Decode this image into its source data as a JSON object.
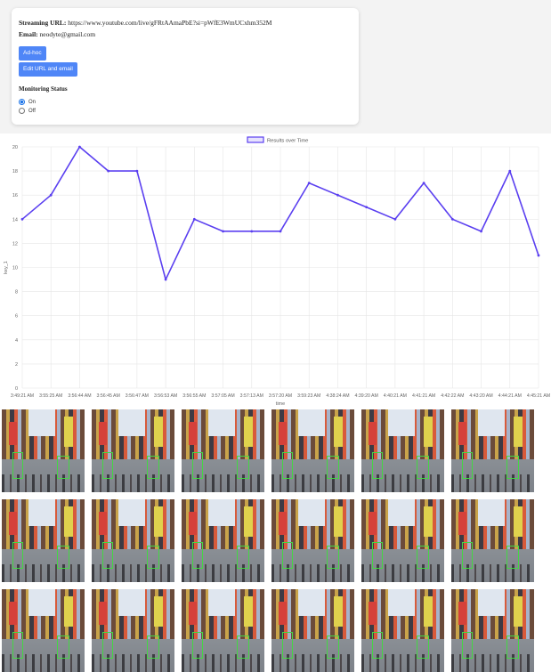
{
  "info": {
    "url_label": "Streaming URL:",
    "url_value": "https://www.youtube.com/live/gFRtAAmaPbE?si=pWfE3WmUCxhm352M",
    "email_label": "Email:",
    "email_value": "neodyte@gmail.com"
  },
  "buttons": {
    "adhoc": "Ad-hoc",
    "edit": "Edit URL and email"
  },
  "monitoring": {
    "title": "Monitoring Status",
    "options": [
      {
        "label": "On",
        "checked": true
      },
      {
        "label": "Off",
        "checked": false
      }
    ]
  },
  "colors": {
    "accent": "#4f86f7",
    "line": "#5a3ff0"
  },
  "chart_data": {
    "type": "line",
    "title": "",
    "xlabel": "time",
    "ylabel": "key_1",
    "ylim": [
      0,
      20
    ],
    "yticks": [
      0,
      2,
      4,
      6,
      8,
      10,
      12,
      14,
      16,
      18,
      20
    ],
    "grid": true,
    "legend_position": "top-center",
    "categories": [
      "3:49:21 AM",
      "3:55:25 AM",
      "3:56:44 AM",
      "3:56:45 AM",
      "3:56:47 AM",
      "3:56:53 AM",
      "3:56:55 AM",
      "3:57:05 AM",
      "3:57:13 AM",
      "3:57:20 AM",
      "3:59:23 AM",
      "4:38:24 AM",
      "4:39:20 AM",
      "4:40:21 AM",
      "4:41:21 AM",
      "4:42:22 AM",
      "4:43:20 AM",
      "4:44:21 AM",
      "4:45:21 AM"
    ],
    "series": [
      {
        "name": "Results over Time",
        "values": [
          14,
          16,
          20,
          18,
          18,
          9,
          14,
          13,
          13,
          13,
          17,
          16,
          15,
          14,
          17,
          14,
          13,
          18,
          11
        ]
      }
    ]
  },
  "thumbnails": {
    "count": 18,
    "icon": "street-camera-frame"
  }
}
